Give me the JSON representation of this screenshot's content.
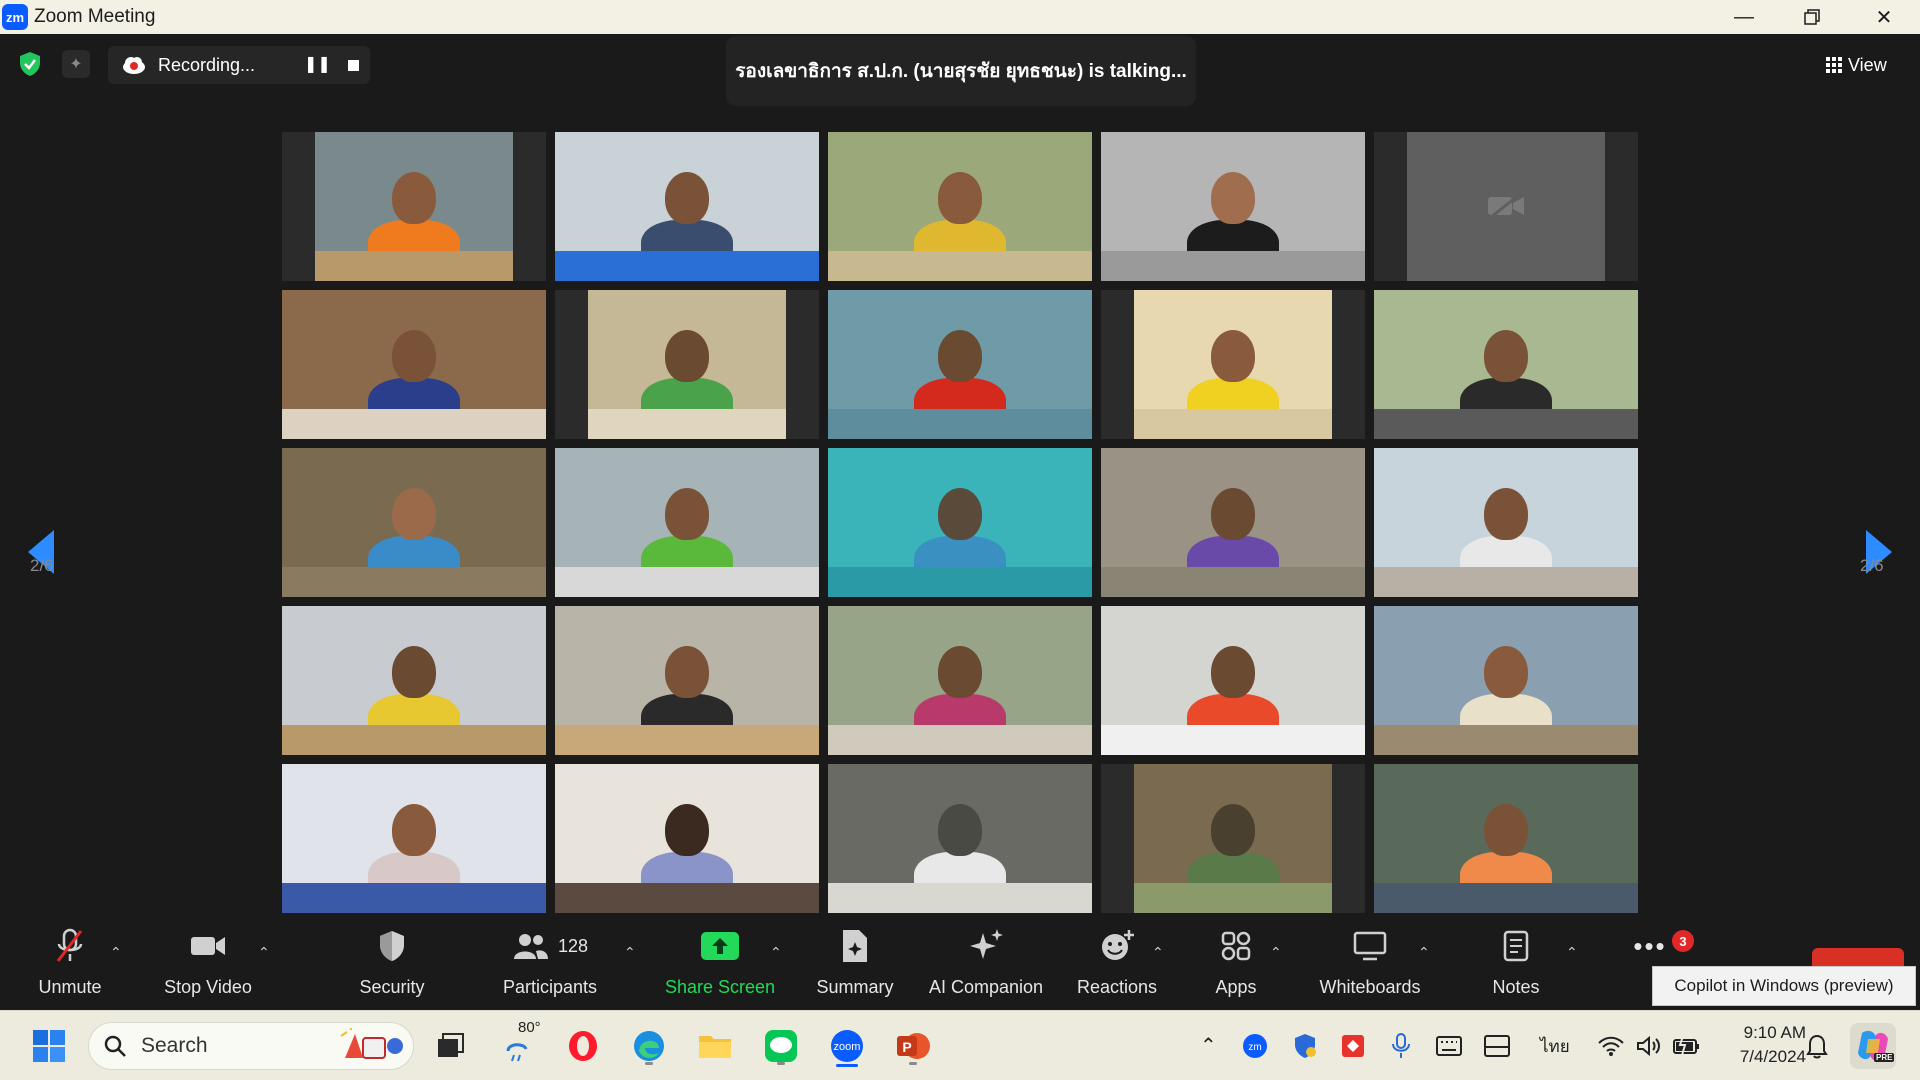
{
  "window": {
    "title": "Zoom Meeting",
    "logo_text": "zm"
  },
  "top_bar": {
    "recording_label": "Recording...",
    "talking_text": "รองเลขาธิการ ส.ป.ก. (นายสุรชัย ยุทธชนะ) is talking...",
    "view_label": "View"
  },
  "page_nav": {
    "left_label": "2/6",
    "right_label": "2/6"
  },
  "toolbar": {
    "unmute": "Unmute",
    "stop_video": "Stop Video",
    "security": "Security",
    "participants": "Participants",
    "participants_count": "128",
    "share_screen": "Share Screen",
    "summary": "Summary",
    "ai_companion": "AI Companion",
    "reactions": "Reactions",
    "apps": "Apps",
    "whiteboards": "Whiteboards",
    "notes": "Notes",
    "more_partial": "M",
    "more_badge": "3",
    "tooltip": "Copilot in Windows (preview)"
  },
  "taskbar": {
    "search_placeholder": "Search",
    "weather_temp": "80°",
    "input_language": "ไทย",
    "time": "9:10 AM",
    "date": "7/4/2024",
    "copilot_badge": "PRE"
  },
  "colors": {
    "accent_blue": "#2d8cff",
    "share_green": "#23d959",
    "meeting_bg": "#1a1a1a",
    "badge_red": "#e02828"
  },
  "tiles": [
    {
      "bg": "#7a8a8c",
      "body": "#f07a1e",
      "head": "#8a5a3c",
      "table": "#b89a6a",
      "narrow": true
    },
    {
      "bg": "#c9d2d6",
      "body": "#3b4d6e",
      "head": "#7a5238",
      "table": "#2a6fd6"
    },
    {
      "bg": "#9aa87a",
      "body": "#e0b830",
      "head": "#8a5a3c",
      "table": "#c8b890"
    },
    {
      "bg": "#b5b5b5",
      "body": "#1c1c1c",
      "head": "#a06e4e",
      "table": "#9a9a9a"
    },
    {
      "bg": "#5f5f5f",
      "body": "#5f5f5f",
      "head": "#5f5f5f",
      "table": "#5f5f5f",
      "off": true,
      "narrow": true
    },
    {
      "bg": "#8a6a4a",
      "body": "#2a3e8c",
      "head": "#7a5238",
      "table": "#ddd2c2"
    },
    {
      "bg": "#c4b896",
      "body": "#4aa24a",
      "head": "#6a4a30",
      "table": "#e0d6c0",
      "narrow": true
    },
    {
      "bg": "#6f9aa8",
      "body": "#d42a1e",
      "head": "#6a4a30",
      "table": "#5e8e9e"
    },
    {
      "bg": "#e8d8b0",
      "body": "#f0d020",
      "head": "#8a5a3c",
      "table": "#d8c8a0",
      "narrow": true
    },
    {
      "bg": "#a8b890",
      "body": "#2a2a2a",
      "head": "#7a5238",
      "table": "#5a5a5a"
    },
    {
      "bg": "#7a6a50",
      "body": "#3a8cc8",
      "head": "#9a6a4a",
      "table": "#8a7a60"
    },
    {
      "bg": "#a6b4b8",
      "body": "#5ab83a",
      "head": "#7a5238",
      "table": "#d8d8d8"
    },
    {
      "bg": "#3ab4b8",
      "body": "#3a90c0",
      "head": "#5a4a3a",
      "table": "#2a9aa6"
    },
    {
      "bg": "#9a9284",
      "body": "#6a4aa8",
      "head": "#6a4a30",
      "table": "#8a8474"
    },
    {
      "bg": "#c8d4dc",
      "body": "#e8e8e8",
      "head": "#7a5238",
      "table": "#b8b0a4"
    },
    {
      "bg": "#c8ccd0",
      "body": "#e8c830",
      "head": "#6a4a30",
      "table": "#b89a6a"
    },
    {
      "bg": "#b8b4a8",
      "body": "#2a2a2a",
      "head": "#7a5238",
      "table": "#c8a878"
    },
    {
      "bg": "#98a488",
      "body": "#b83a6a",
      "head": "#6a4a30",
      "table": "#d0cabc"
    },
    {
      "bg": "#d4d4d0",
      "body": "#e84a2a",
      "head": "#6a4a30",
      "table": "#f0f0f0"
    },
    {
      "bg": "#8aa0b0",
      "body": "#e8e0c8",
      "head": "#8a5a3c",
      "table": "#9a8a70"
    },
    {
      "bg": "#e0e4ea",
      "body": "#d8c8c8",
      "head": "#8a5a3c",
      "table": "#3a5aa8"
    },
    {
      "bg": "#e8e4dc",
      "body": "#8a94c8",
      "head": "#3a2a20",
      "table": "#5a4a40"
    },
    {
      "bg": "#6a6a64",
      "body": "#e8e8e8",
      "head": "#4a4a44",
      "table": "#d8d8d0"
    },
    {
      "bg": "#7a6a50",
      "body": "#5a7a4a",
      "head": "#4a4030",
      "table": "#8a9a6a",
      "narrow": true
    },
    {
      "bg": "#5a6a5a",
      "body": "#f08a4a",
      "head": "#7a5238",
      "table": "#4a5a6a"
    }
  ]
}
